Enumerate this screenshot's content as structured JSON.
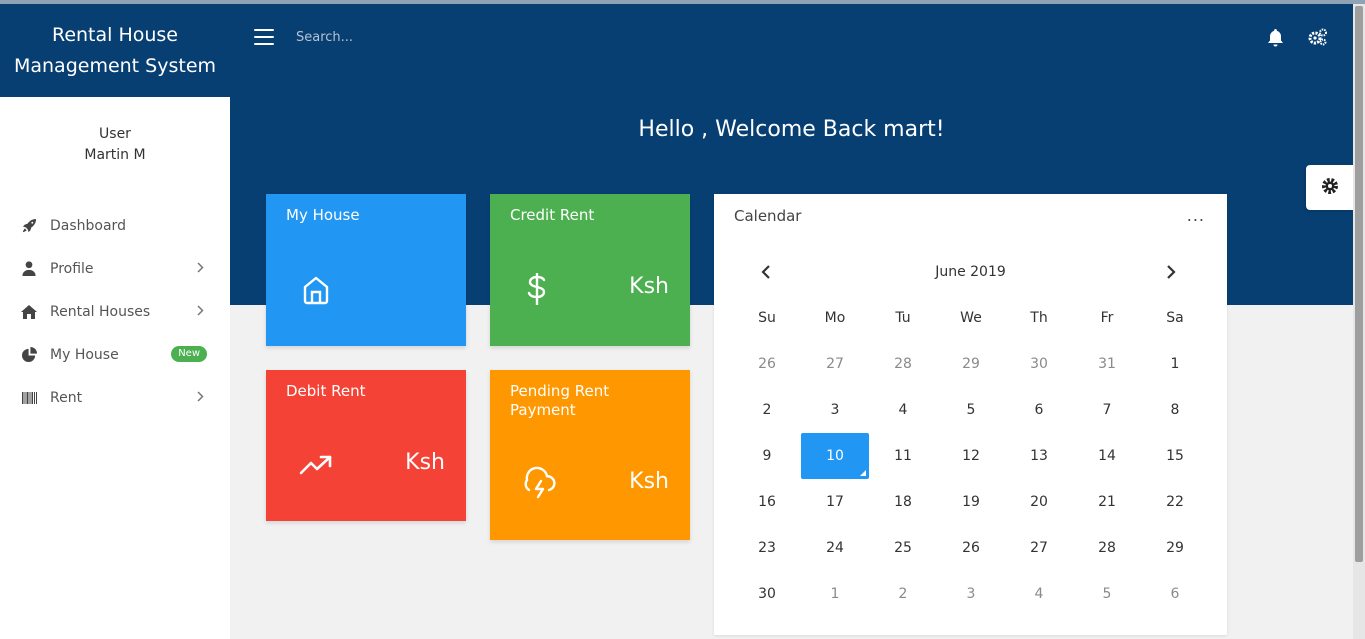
{
  "brand": {
    "line1": "Rental House",
    "line2": "Management System"
  },
  "user": {
    "role": "User",
    "name": "Martin M"
  },
  "sidebar": {
    "items": [
      {
        "label": "Dashboard",
        "icon": "rocket-icon"
      },
      {
        "label": "Profile",
        "icon": "user-icon"
      },
      {
        "label": "Rental Houses",
        "icon": "home-icon"
      },
      {
        "label": "My House",
        "icon": "pie-chart-icon",
        "badge": "New"
      },
      {
        "label": "Rent",
        "icon": "barcode-icon"
      }
    ]
  },
  "header": {
    "search_placeholder": "Search...",
    "welcome": "Hello , Welcome Back  mart!"
  },
  "cards": {
    "my_house": {
      "title": "My House"
    },
    "credit": {
      "title": "Credit Rent",
      "value": "Ksh"
    },
    "debit": {
      "title": "Debit Rent",
      "value": "Ksh"
    },
    "pending": {
      "title": "Pending Rent Payment",
      "value": "Ksh"
    }
  },
  "calendar": {
    "title": "Calendar",
    "more": "...",
    "month": "June 2019",
    "weekdays": [
      "Su",
      "Mo",
      "Tu",
      "We",
      "Th",
      "Fr",
      "Sa"
    ],
    "weeks": [
      [
        {
          "d": "26",
          "m": true
        },
        {
          "d": "27",
          "m": true
        },
        {
          "d": "28",
          "m": true
        },
        {
          "d": "29",
          "m": true
        },
        {
          "d": "30",
          "m": true
        },
        {
          "d": "31",
          "m": true
        },
        {
          "d": "1"
        }
      ],
      [
        {
          "d": "2"
        },
        {
          "d": "3"
        },
        {
          "d": "4"
        },
        {
          "d": "5"
        },
        {
          "d": "6"
        },
        {
          "d": "7"
        },
        {
          "d": "8"
        }
      ],
      [
        {
          "d": "9"
        },
        {
          "d": "10",
          "active": true
        },
        {
          "d": "11"
        },
        {
          "d": "12"
        },
        {
          "d": "13"
        },
        {
          "d": "14"
        },
        {
          "d": "15"
        }
      ],
      [
        {
          "d": "16"
        },
        {
          "d": "17"
        },
        {
          "d": "18"
        },
        {
          "d": "19"
        },
        {
          "d": "20"
        },
        {
          "d": "21"
        },
        {
          "d": "22"
        }
      ],
      [
        {
          "d": "23"
        },
        {
          "d": "24"
        },
        {
          "d": "25"
        },
        {
          "d": "26"
        },
        {
          "d": "27"
        },
        {
          "d": "28"
        },
        {
          "d": "29"
        }
      ],
      [
        {
          "d": "30"
        },
        {
          "d": "1",
          "m": true
        },
        {
          "d": "2",
          "m": true
        },
        {
          "d": "3",
          "m": true
        },
        {
          "d": "4",
          "m": true
        },
        {
          "d": "5",
          "m": true
        },
        {
          "d": "6",
          "m": true
        }
      ]
    ]
  },
  "colors": {
    "header_bg": "#083f73",
    "blue": "#2196f3",
    "green": "#4caf50",
    "red": "#f44336",
    "orange": "#ff9800"
  }
}
